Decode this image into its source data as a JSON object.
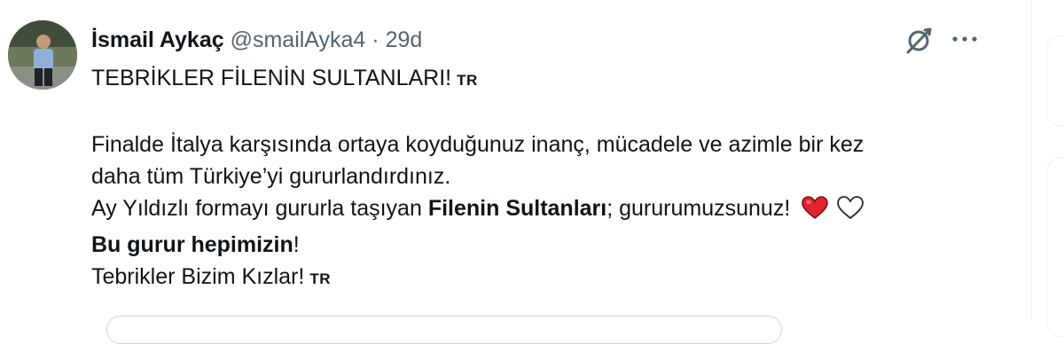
{
  "tweet": {
    "author_name": "İsmail Aykaç",
    "handle": "@smailAyka4",
    "separator": "·",
    "time": "29d",
    "grok_icon": "grok-slash-icon",
    "more_icon": "more-horizontal-icon",
    "lines": {
      "l1": "TEBRİKLER FİLENİN SULTANLARI!",
      "l2": "Finalde İtalya karşısında ortaya koyduğunuz inanç, mücadele ve azimle bir kez",
      "l3": "daha tüm Türkiye’yi gururlandırdınız.",
      "l4_pre": "Ay Yıldızlı formayı gururla taşıyan ",
      "l4_bold": "Filenin Sultanları",
      "l4_post": "; gururumuzsunuz!",
      "l5_bold": "Bu gurur hepimizin",
      "l5_post": "!",
      "l6": "Tebrikler Bizim Kızlar!"
    },
    "flag_label": "TR",
    "emoji": [
      "red-heart",
      "white-heart"
    ],
    "colors": {
      "text": "#0f1419",
      "muted": "#536471",
      "heart_red": "#e0242f"
    }
  }
}
